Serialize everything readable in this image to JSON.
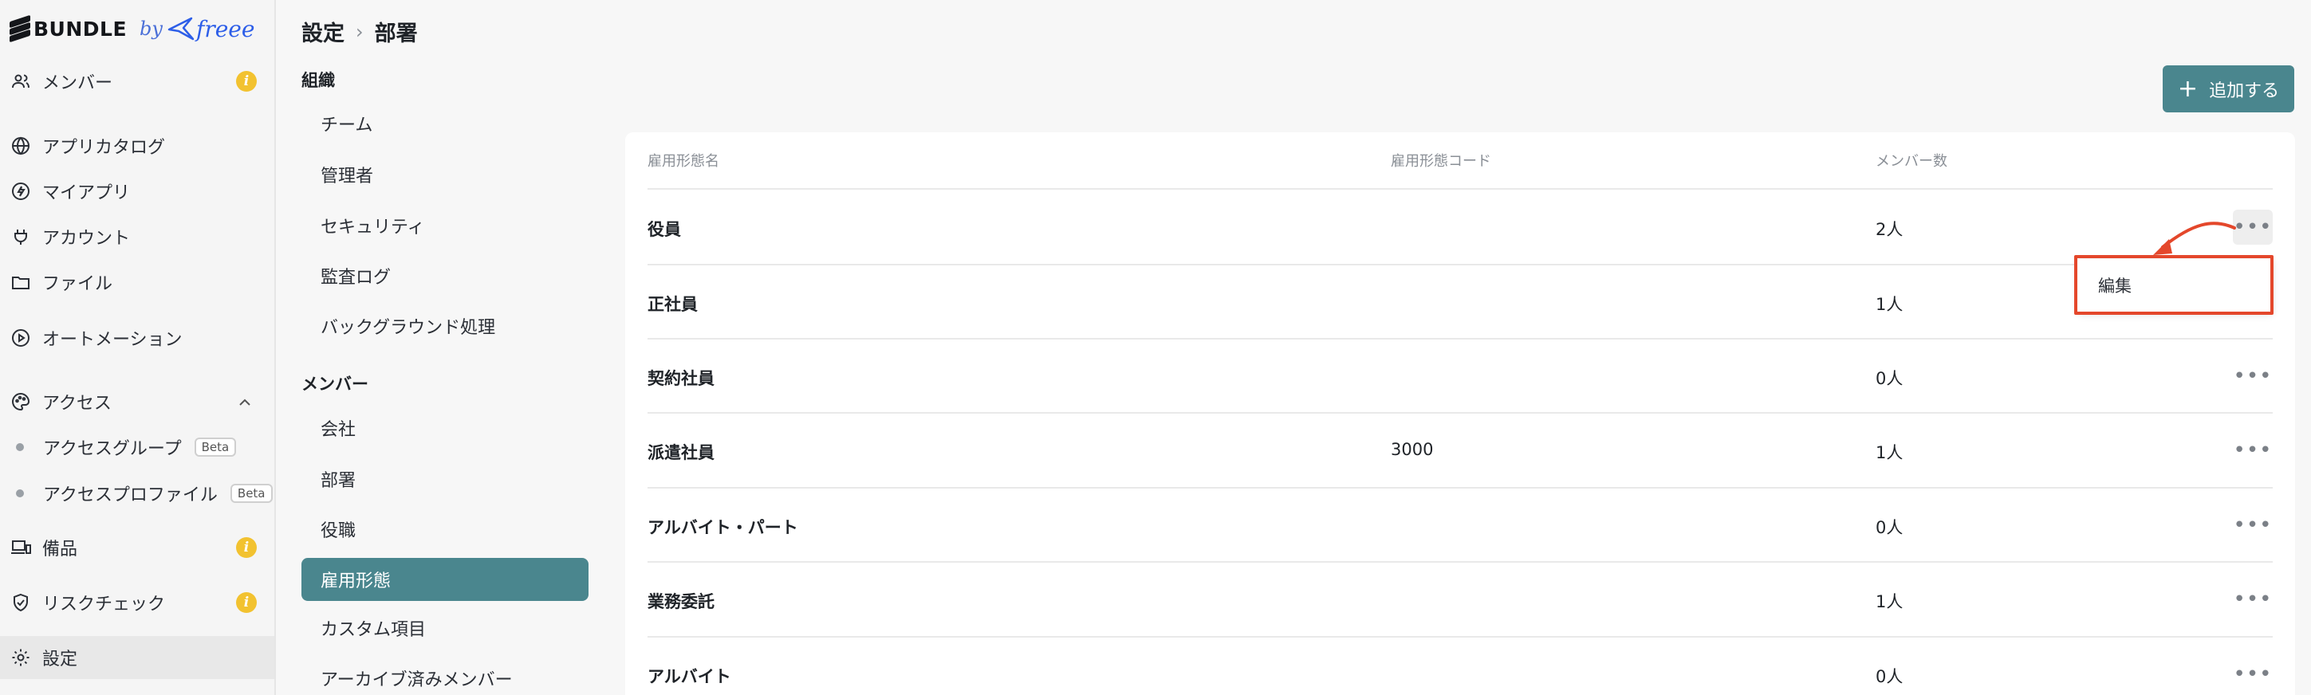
{
  "brand": {
    "name": "BUNDLE",
    "by": "by",
    "partner": "freee"
  },
  "nav": {
    "items": [
      {
        "label": "メンバー",
        "icon": "users-icon",
        "info": "i"
      },
      {
        "label": "アプリカタログ",
        "icon": "globe-icon"
      },
      {
        "label": "マイアプリ",
        "icon": "bolt-icon"
      },
      {
        "label": "アカウント",
        "icon": "plug-icon"
      },
      {
        "label": "ファイル",
        "icon": "folder-icon"
      },
      {
        "label": "オートメーション",
        "icon": "play-circle-icon"
      },
      {
        "label": "アクセス",
        "icon": "palette-icon"
      },
      {
        "label": "備品",
        "icon": "devices-icon",
        "info": "i"
      },
      {
        "label": "リスクチェック",
        "icon": "shield-check-icon",
        "info": "i"
      },
      {
        "label": "設定",
        "icon": "gear-icon"
      }
    ],
    "access_sub": [
      {
        "label": "アクセスグループ",
        "badge": "Beta"
      },
      {
        "label": "アクセスプロファイル",
        "badge": "Beta"
      }
    ]
  },
  "breadcrumb": {
    "parent": "設定",
    "separator": "›",
    "current": "部署"
  },
  "settings_menu": {
    "org_heading": "組織",
    "org_items": [
      "チーム",
      "管理者",
      "セキュリティ",
      "監査ログ",
      "バックグラウンド処理"
    ],
    "member_heading": "メンバー",
    "member_items": [
      "会社",
      "部署",
      "役職",
      "雇用形態",
      "カスタム項目",
      "アーカイブ済みメンバー"
    ],
    "active": "雇用形態"
  },
  "toolbar": {
    "add_label": "追加する"
  },
  "table": {
    "headers": [
      "雇用形態名",
      "雇用形態コード",
      "メンバー数"
    ],
    "rows": [
      {
        "name": "役員",
        "code": "",
        "count": "2人"
      },
      {
        "name": "正社員",
        "code": "",
        "count": "1人"
      },
      {
        "name": "契約社員",
        "code": "",
        "count": "0人"
      },
      {
        "name": "派遣社員",
        "code": "3000",
        "count": "1人"
      },
      {
        "name": "アルバイト・パート",
        "code": "",
        "count": "0人"
      },
      {
        "name": "業務委託",
        "code": "",
        "count": "1人"
      },
      {
        "name": "アルバイト",
        "code": "",
        "count": "0人"
      }
    ],
    "more_glyph": "•••"
  },
  "row_menu": {
    "edit_label": "編集"
  },
  "colors": {
    "accent": "#4a868e",
    "annotation": "#e4472b",
    "info": "#f2c230"
  }
}
